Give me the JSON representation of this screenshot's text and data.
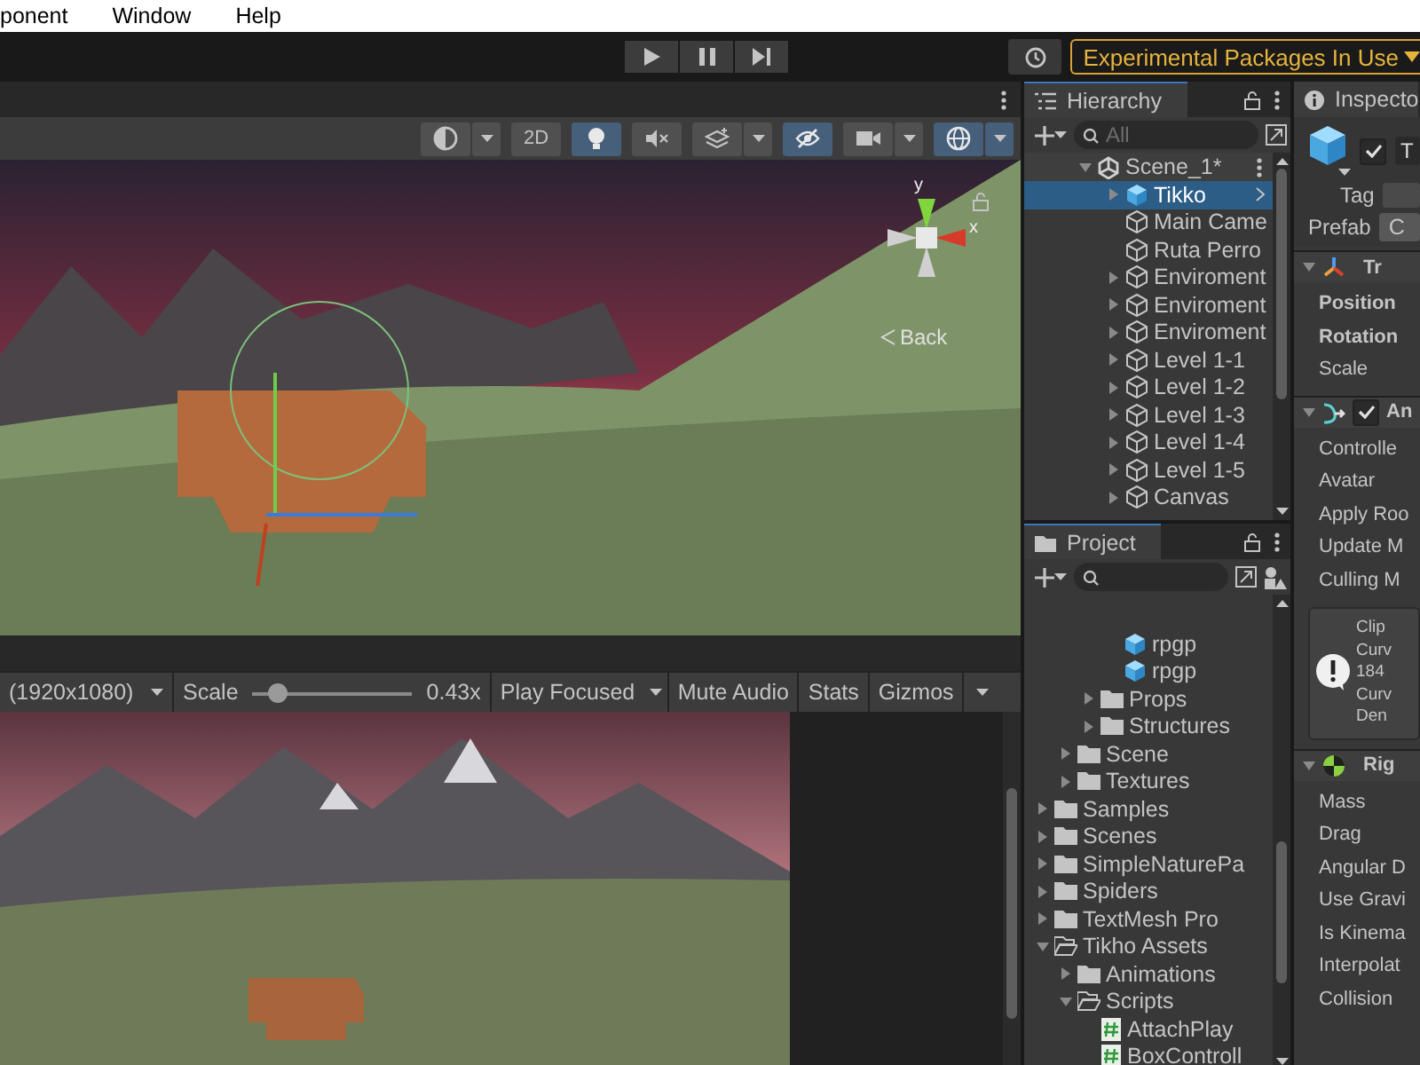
{
  "menu_bar": {
    "items": [
      "ponent",
      "Window",
      "Help"
    ]
  },
  "toolbar": {
    "packages_button": "Experimental Packages In Use"
  },
  "scene_view": {
    "tools": [
      {
        "kind": "draw-mode",
        "active": false,
        "dropdown": true
      },
      {
        "kind": "text",
        "label": "2D",
        "active": false,
        "dropdown": false
      },
      {
        "kind": "light",
        "active": true,
        "dropdown": false
      },
      {
        "kind": "audio",
        "active": false,
        "dropdown": false
      },
      {
        "kind": "effects",
        "active": false,
        "dropdown": true
      },
      {
        "kind": "visibility",
        "active": true,
        "dropdown": false
      },
      {
        "kind": "camera",
        "active": false,
        "dropdown": true
      },
      {
        "kind": "gizmos",
        "active": true,
        "dropdown": true
      }
    ],
    "gizmo": {
      "y_label": "y",
      "x_label": "x"
    },
    "back_label": "Back"
  },
  "game_view": {
    "resolution": "(1920x1080)",
    "scale_label": "Scale",
    "scale": {
      "level": 0.15
    },
    "scale_reading": "0.43x",
    "play_mode": "Play Focused",
    "buttons": [
      "Mute Audio",
      "Stats"
    ],
    "gizmos": "Gizmos"
  },
  "hierarchy": {
    "title": "Hierarchy",
    "search": {
      "placeholder": "All"
    },
    "scene": {
      "label": "Scene_1*",
      "expanded": true,
      "children": [
        {
          "label": "Tikko",
          "kind": "prefab",
          "selected": true,
          "expanded": false
        },
        {
          "label": "Main Came",
          "kind": "object",
          "selected": false
        },
        {
          "label": "Ruta Perro",
          "kind": "object",
          "selected": false
        },
        {
          "label": "Enviroment",
          "kind": "object",
          "selected": false,
          "expanded": false
        },
        {
          "label": "Enviroment",
          "kind": "object",
          "selected": false,
          "expanded": false
        },
        {
          "label": "Enviroment",
          "kind": "object",
          "selected": false,
          "expanded": false
        },
        {
          "label": "Level 1-1",
          "kind": "object",
          "selected": false,
          "expanded": false
        },
        {
          "label": "Level 1-2",
          "kind": "object",
          "selected": false,
          "expanded": false
        },
        {
          "label": "Level 1-3",
          "kind": "object",
          "selected": false,
          "expanded": false
        },
        {
          "label": "Level 1-4",
          "kind": "object",
          "selected": false,
          "expanded": false
        },
        {
          "label": "Level 1-5",
          "kind": "object",
          "selected": false,
          "expanded": false
        },
        {
          "label": "Canvas",
          "kind": "object",
          "selected": false,
          "expanded": false
        }
      ]
    }
  },
  "project": {
    "title": "Project",
    "items": [
      {
        "children": [
          {
            "children": [
              {
                "children": [
                  {
                    "label": "rpgp",
                    "kind": "prefab"
                  },
                  {
                    "label": "rpgp",
                    "kind": "prefab"
                  }
                ]
              },
              {
                "label": "Props",
                "kind": "folder",
                "expanded": false
              },
              {
                "label": "Structures",
                "kind": "folder",
                "expanded": false
              }
            ]
          },
          {
            "label": "Scene",
            "kind": "folder",
            "expanded": false
          },
          {
            "label": "Textures",
            "kind": "folder",
            "expanded": false
          }
        ]
      },
      {
        "label": "Samples",
        "kind": "folder",
        "expanded": false
      },
      {
        "label": "Scenes",
        "kind": "folder",
        "expanded": false
      },
      {
        "label": "SimpleNaturePa",
        "kind": "folder",
        "expanded": false
      },
      {
        "label": "Spiders",
        "kind": "folder",
        "expanded": false
      },
      {
        "label": "TextMesh Pro",
        "kind": "folder",
        "expanded": false
      },
      {
        "label": "Tikho Assets",
        "kind": "folder",
        "expanded": true,
        "children": [
          {
            "label": "Animations",
            "kind": "folder",
            "expanded": false
          },
          {
            "label": "Scripts",
            "kind": "folder",
            "expanded": true,
            "children": [
              {
                "label": "AttachPlay",
                "kind": "script"
              },
              {
                "label": "BoxControll",
                "kind": "script"
              }
            ]
          }
        ]
      }
    ]
  },
  "inspector": {
    "title": "Inspecto",
    "object": {
      "active": true,
      "name": "T",
      "tag_label": "Tag",
      "prefab_label": "Prefab",
      "prefab_button": "C"
    },
    "components": [
      {
        "kind": "transform",
        "title": "Tr",
        "expanded": true,
        "fields": [
          {
            "label": "Position",
            "overridden": true
          },
          {
            "label": "Rotation",
            "overridden": true
          },
          {
            "label": "Scale",
            "overridden": false
          }
        ]
      },
      {
        "kind": "animator",
        "title": "An",
        "expanded": true,
        "enabled": true,
        "fields": [
          {
            "label": "Controlle",
            "overridden": false
          },
          {
            "label": "Avatar",
            "overridden": false
          },
          {
            "label": "Apply Roo",
            "overridden": false
          },
          {
            "label": "Update M",
            "overridden": false
          },
          {
            "label": "Culling M",
            "overridden": false
          }
        ],
        "help": [
          "Clip",
          "Curv",
          "184",
          "Curv",
          "Den"
        ]
      },
      {
        "kind": "rigidbody",
        "title": "Rig",
        "expanded": true,
        "fields": [
          {
            "label": "Mass",
            "overridden": false
          },
          {
            "label": "Drag",
            "overridden": false
          },
          {
            "label": "Angular D",
            "overridden": false
          },
          {
            "label": "Use Gravi",
            "overridden": false
          },
          {
            "label": "Is Kinema",
            "overridden": false
          },
          {
            "label": "Interpolat",
            "overridden": false
          },
          {
            "label": "Collision",
            "overridden": false
          }
        ]
      }
    ]
  }
}
